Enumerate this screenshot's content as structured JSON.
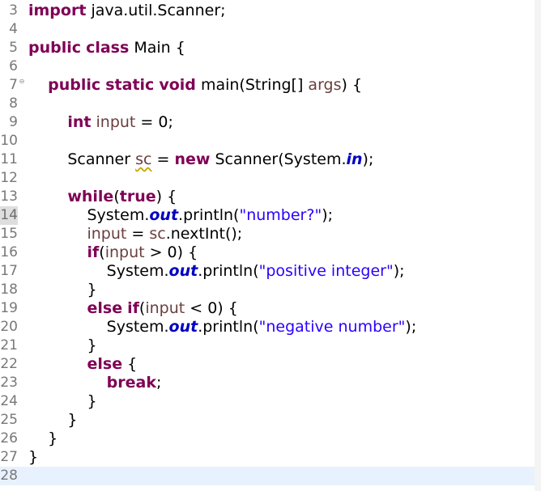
{
  "editor": {
    "lines": [
      {
        "num": "3",
        "code": [
          {
            "t": "import",
            "c": "kw"
          },
          {
            "t": " java.util.Scanner;"
          }
        ]
      },
      {
        "num": "4",
        "code": []
      },
      {
        "num": "5",
        "code": [
          {
            "t": "public",
            "c": "kw"
          },
          {
            "t": " "
          },
          {
            "t": "class",
            "c": "kw"
          },
          {
            "t": " Main {"
          }
        ]
      },
      {
        "num": "6",
        "code": []
      },
      {
        "num": "7",
        "fold": "⊖",
        "code": [
          {
            "t": "    "
          },
          {
            "t": "public",
            "c": "kw"
          },
          {
            "t": " "
          },
          {
            "t": "static",
            "c": "kw"
          },
          {
            "t": " "
          },
          {
            "t": "void",
            "c": "kw"
          },
          {
            "t": " main(String[] "
          },
          {
            "t": "args",
            "c": "var"
          },
          {
            "t": ") {"
          }
        ]
      },
      {
        "num": "8",
        "code": []
      },
      {
        "num": "9",
        "code": [
          {
            "t": "        "
          },
          {
            "t": "int",
            "c": "kw"
          },
          {
            "t": " "
          },
          {
            "t": "input",
            "c": "var"
          },
          {
            "t": " = 0;"
          }
        ]
      },
      {
        "num": "10",
        "code": []
      },
      {
        "num": "11",
        "code": [
          {
            "t": "        Scanner "
          },
          {
            "t": "sc",
            "c": "var squig"
          },
          {
            "t": " = "
          },
          {
            "t": "new",
            "c": "kw"
          },
          {
            "t": " Scanner(System."
          },
          {
            "t": "in",
            "c": "fld"
          },
          {
            "t": ");"
          }
        ]
      },
      {
        "num": "12",
        "code": []
      },
      {
        "num": "13",
        "code": [
          {
            "t": "        "
          },
          {
            "t": "while",
            "c": "kw"
          },
          {
            "t": "("
          },
          {
            "t": "true",
            "c": "kw"
          },
          {
            "t": ") {"
          }
        ]
      },
      {
        "num": "14",
        "active": true,
        "code": [
          {
            "t": "            System."
          },
          {
            "t": "out",
            "c": "fld"
          },
          {
            "t": ".println("
          },
          {
            "t": "\"number?\"",
            "c": "str"
          },
          {
            "t": ");"
          }
        ]
      },
      {
        "num": "15",
        "code": [
          {
            "t": "            "
          },
          {
            "t": "input",
            "c": "var"
          },
          {
            "t": " = "
          },
          {
            "t": "sc",
            "c": "var"
          },
          {
            "t": ".nextInt();"
          }
        ]
      },
      {
        "num": "16",
        "code": [
          {
            "t": "            "
          },
          {
            "t": "if",
            "c": "kw"
          },
          {
            "t": "("
          },
          {
            "t": "input",
            "c": "var"
          },
          {
            "t": " > 0) {"
          }
        ]
      },
      {
        "num": "17",
        "code": [
          {
            "t": "                System."
          },
          {
            "t": "out",
            "c": "fld"
          },
          {
            "t": ".println("
          },
          {
            "t": "\"positive integer\"",
            "c": "str"
          },
          {
            "t": ");"
          }
        ]
      },
      {
        "num": "18",
        "code": [
          {
            "t": "            }"
          }
        ]
      },
      {
        "num": "19",
        "code": [
          {
            "t": "            "
          },
          {
            "t": "else",
            "c": "kw"
          },
          {
            "t": " "
          },
          {
            "t": "if",
            "c": "kw"
          },
          {
            "t": "("
          },
          {
            "t": "input",
            "c": "var"
          },
          {
            "t": " < 0) {"
          }
        ]
      },
      {
        "num": "20",
        "code": [
          {
            "t": "                System."
          },
          {
            "t": "out",
            "c": "fld"
          },
          {
            "t": ".println("
          },
          {
            "t": "\"negative number\"",
            "c": "str"
          },
          {
            "t": ");"
          }
        ]
      },
      {
        "num": "21",
        "code": [
          {
            "t": "            }"
          }
        ]
      },
      {
        "num": "22",
        "code": [
          {
            "t": "            "
          },
          {
            "t": "else",
            "c": "kw"
          },
          {
            "t": " {"
          }
        ]
      },
      {
        "num": "23",
        "code": [
          {
            "t": "                "
          },
          {
            "t": "break",
            "c": "kw"
          },
          {
            "t": ";"
          }
        ]
      },
      {
        "num": "24",
        "code": [
          {
            "t": "            }"
          }
        ]
      },
      {
        "num": "25",
        "code": [
          {
            "t": "        }"
          }
        ]
      },
      {
        "num": "26",
        "code": [
          {
            "t": "    }"
          }
        ]
      },
      {
        "num": "27",
        "code": [
          {
            "t": "}"
          }
        ]
      },
      {
        "num": "28",
        "current": true,
        "code": []
      }
    ]
  }
}
